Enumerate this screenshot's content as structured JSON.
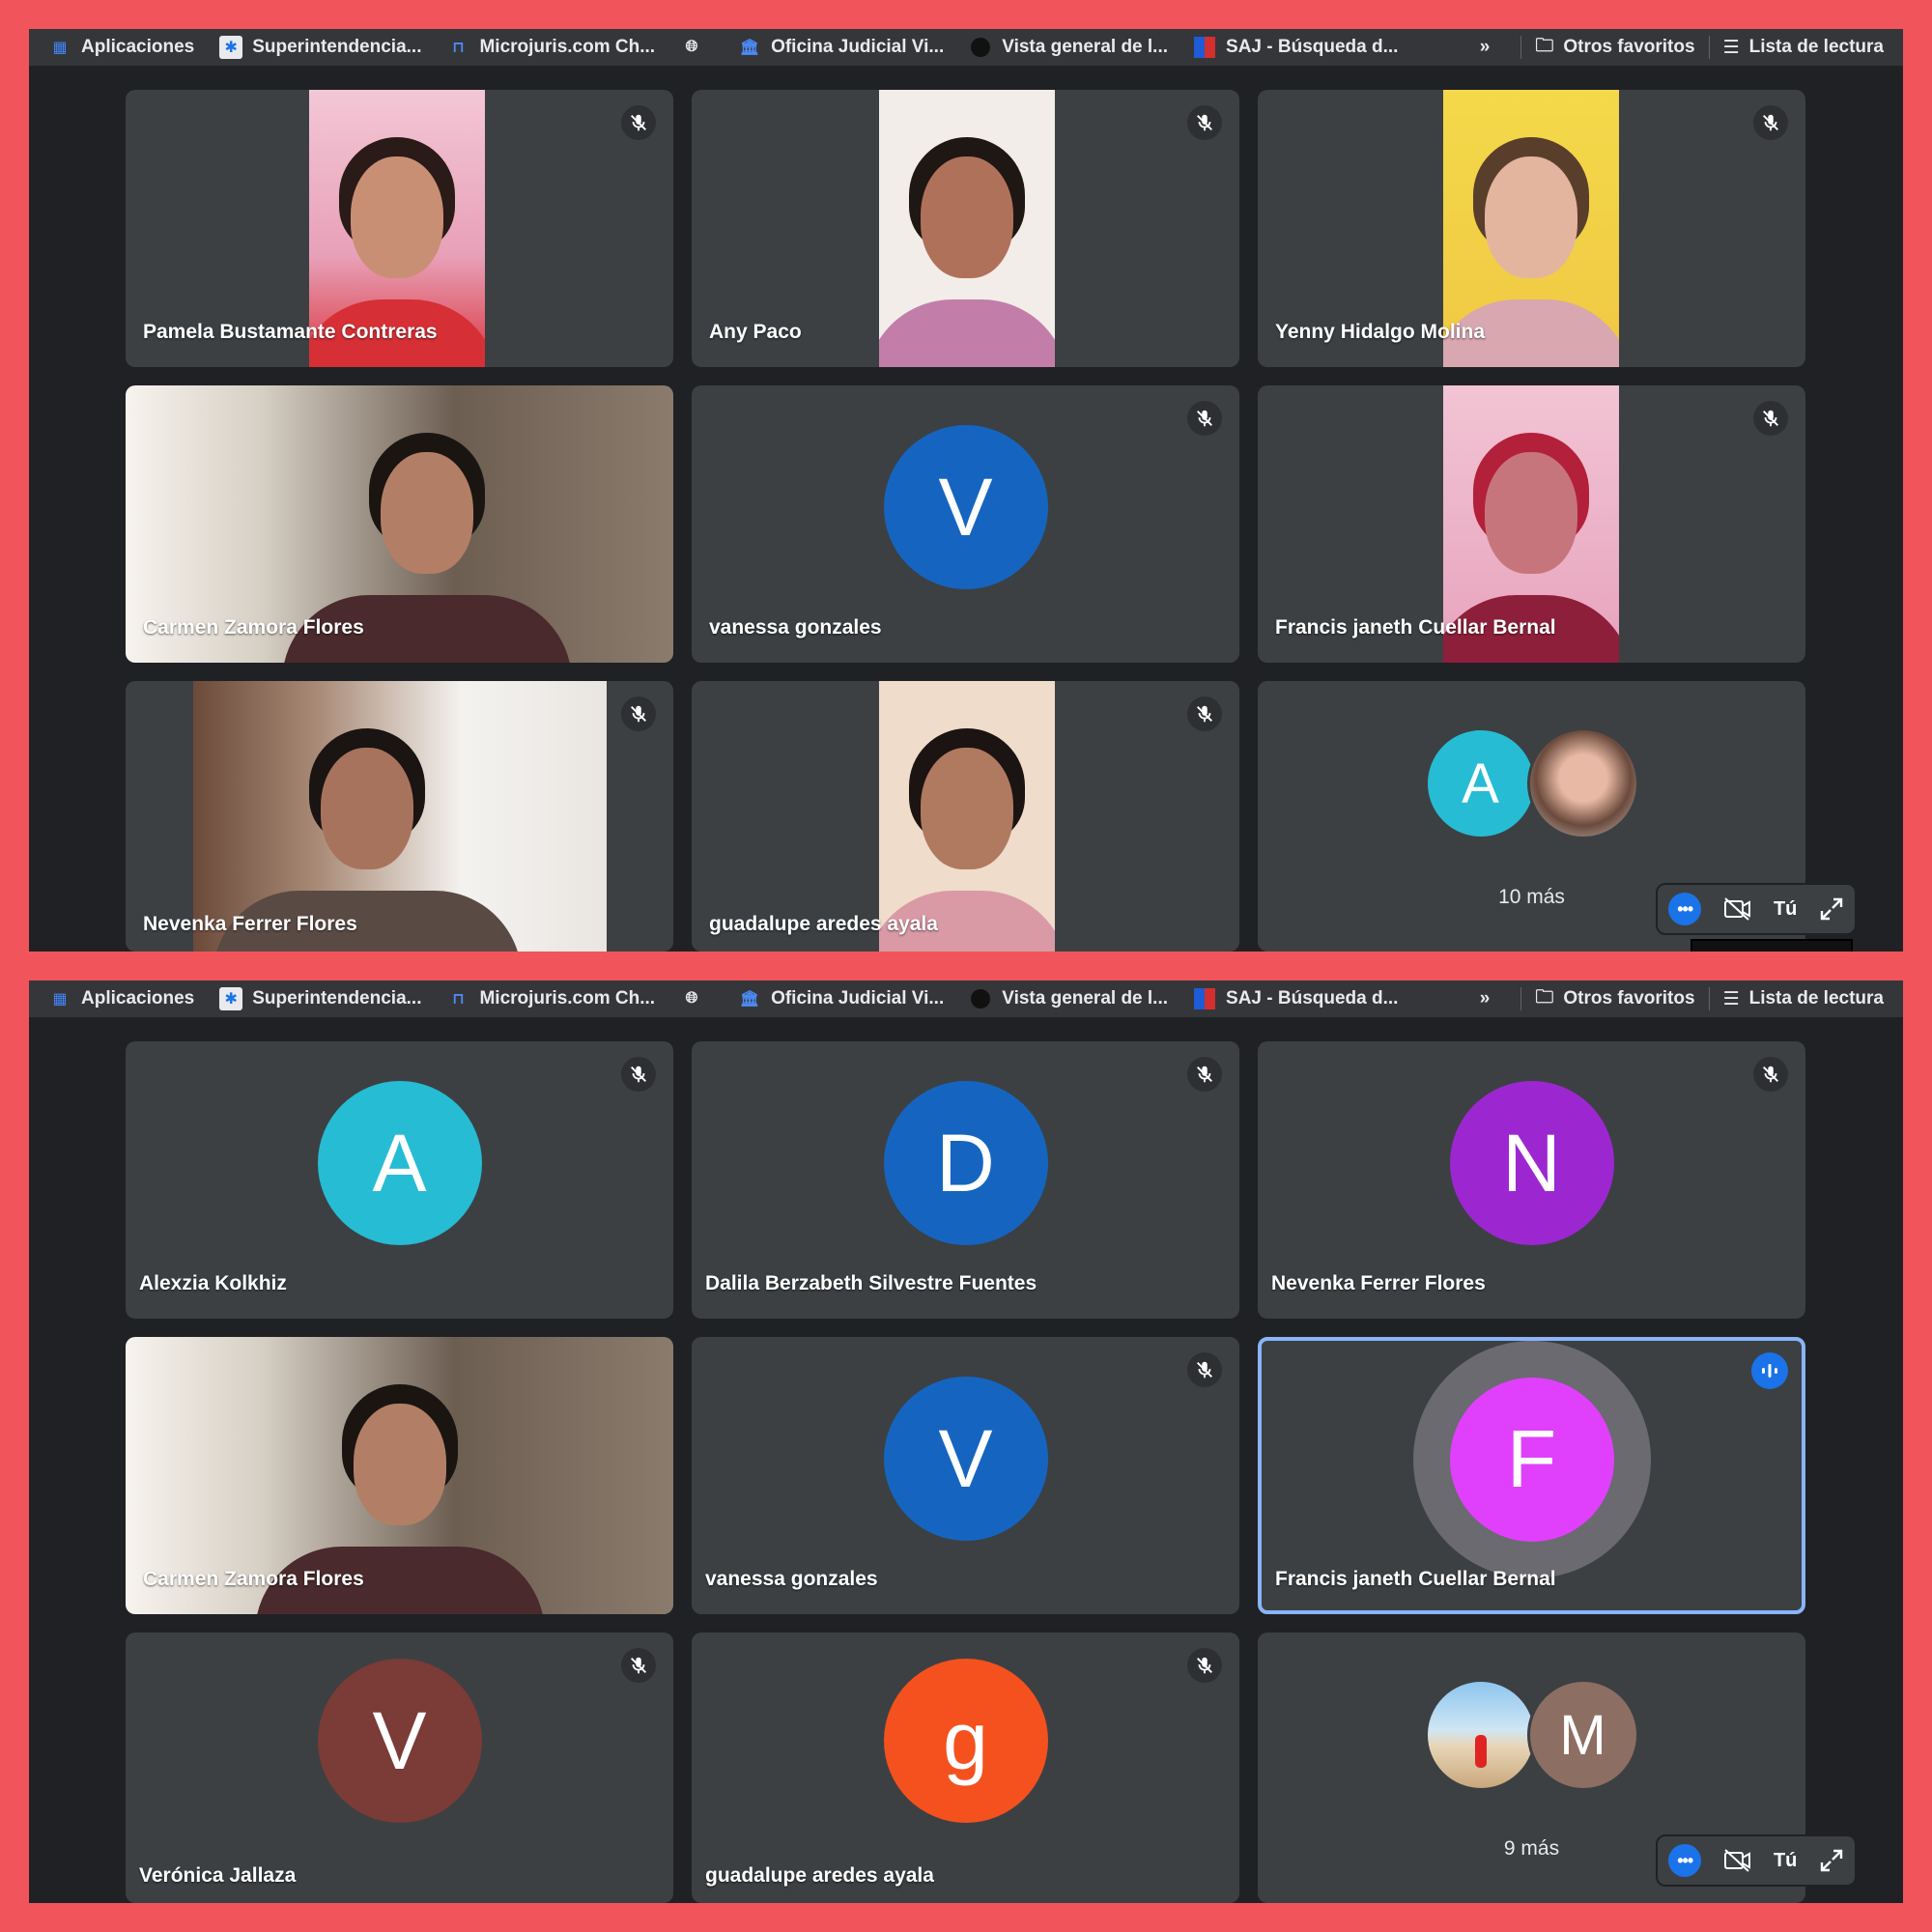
{
  "bookmarks": [
    {
      "label": "Aplicaciones",
      "icon": "apps-grid-icon"
    },
    {
      "label": "Superintendencia...",
      "icon": "superintendencia-icon"
    },
    {
      "label": "Microjuris.com Ch...",
      "icon": "microjuris-icon"
    },
    {
      "label": "",
      "icon": "globe-icon"
    },
    {
      "label": "Oficina Judicial Vi...",
      "icon": "bank-icon"
    },
    {
      "label": "Vista general de l...",
      "icon": "circle-icon"
    },
    {
      "label": "SAJ - Búsqueda d...",
      "icon": "flag-icon"
    }
  ],
  "bookmarks_right": {
    "overflow": "»",
    "other": "Otros favoritos",
    "reading": "Lista de lectura"
  },
  "screen1": {
    "tiles": [
      {
        "name": "Pamela Bustamante Contreras",
        "muted": true
      },
      {
        "name": "Any Paco",
        "muted": true
      },
      {
        "name": "Yenny Hidalgo Molina",
        "muted": true
      },
      {
        "name": "Carmen Zamora Flores",
        "muted": false
      },
      {
        "name": "vanessa gonzales",
        "muted": true,
        "initial": "V",
        "color": "#1565c0"
      },
      {
        "name": "Francis janeth Cuellar Bernal",
        "muted": true
      },
      {
        "name": "Nevenka Ferrer Flores",
        "muted": true
      },
      {
        "name": "guadalupe aredes ayala",
        "muted": true
      }
    ],
    "more": {
      "initial": "A",
      "color": "#26bcd4",
      "label": "10 más"
    },
    "self": {
      "label": "Tú"
    }
  },
  "screen2": {
    "tiles": [
      {
        "name": "Alexzia Kolkhiz",
        "muted": true,
        "initial": "A",
        "color": "#26bcd4"
      },
      {
        "name": "Dalila Berzabeth Silvestre Fuentes",
        "muted": true,
        "initial": "D",
        "color": "#1565c0"
      },
      {
        "name": "Nevenka Ferrer Flores",
        "muted": true,
        "initial": "N",
        "color": "#9c27d0"
      },
      {
        "name": "Carmen Zamora Flores",
        "muted": false
      },
      {
        "name": "vanessa gonzales",
        "muted": true,
        "initial": "V",
        "color": "#1565c0"
      },
      {
        "name": "Francis janeth Cuellar Bernal",
        "speaking": true,
        "initial": "F",
        "color": "#e040fb"
      },
      {
        "name": "Verónica Jallaza",
        "muted": true,
        "initial": "V",
        "color": "#7b3b36"
      },
      {
        "name": "guadalupe aredes ayala",
        "muted": true,
        "initial": "g",
        "color": "#f4511e"
      }
    ],
    "more": {
      "initial": "M",
      "color": "#8d6e63",
      "label": "9 más"
    },
    "self": {
      "label": "Tú"
    }
  }
}
